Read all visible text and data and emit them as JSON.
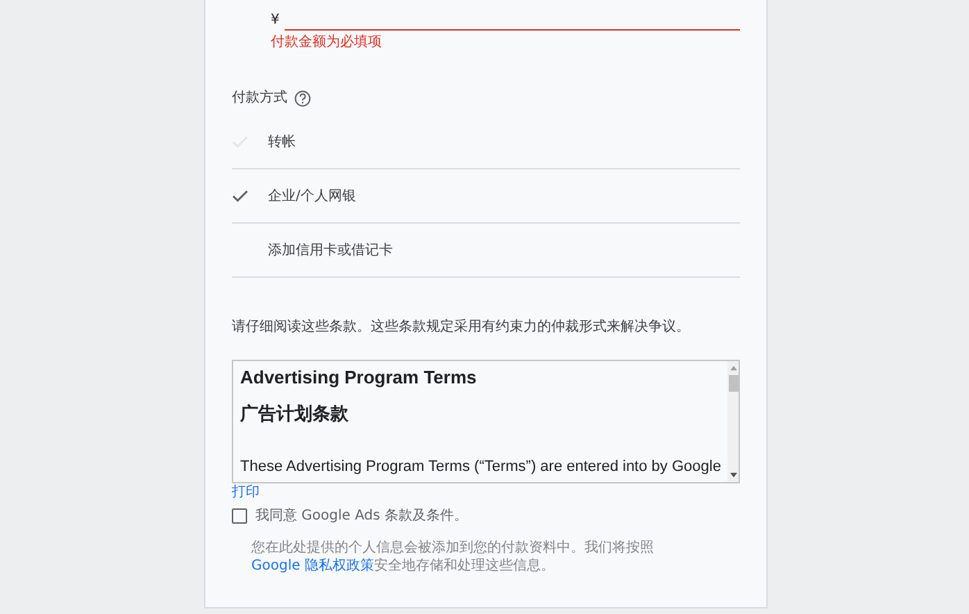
{
  "amount_field": {
    "currency": "¥",
    "error": "付款金额为必填项"
  },
  "payment_method": {
    "label": "付款方式",
    "options": [
      {
        "label": "转帐",
        "selected": false,
        "hovered": true
      },
      {
        "label": "企业/个人网银",
        "selected": true,
        "hovered": false
      },
      {
        "label": "添加信用卡或借记卡",
        "selected": false,
        "hovered": false
      }
    ]
  },
  "terms_notice": "请仔细阅读这些条款。这些条款规定采用有约束力的仲裁形式来解决争议。",
  "terms_box": {
    "title": "Advertising Program Terms",
    "subtitle": "广告计划条款",
    "paragraph": "These Advertising Program Terms (“Terms”) are entered into by Google"
  },
  "print_link": "打印",
  "agree": {
    "label": "我同意 Google Ads 条款及条件。",
    "checked": false
  },
  "privacy_note": {
    "before": "您在此处提供的个人信息会被添加到您的付款资料中。我们将按照",
    "link": "Google 隐私权政策",
    "after": "安全地存储和处理这些信息。"
  }
}
